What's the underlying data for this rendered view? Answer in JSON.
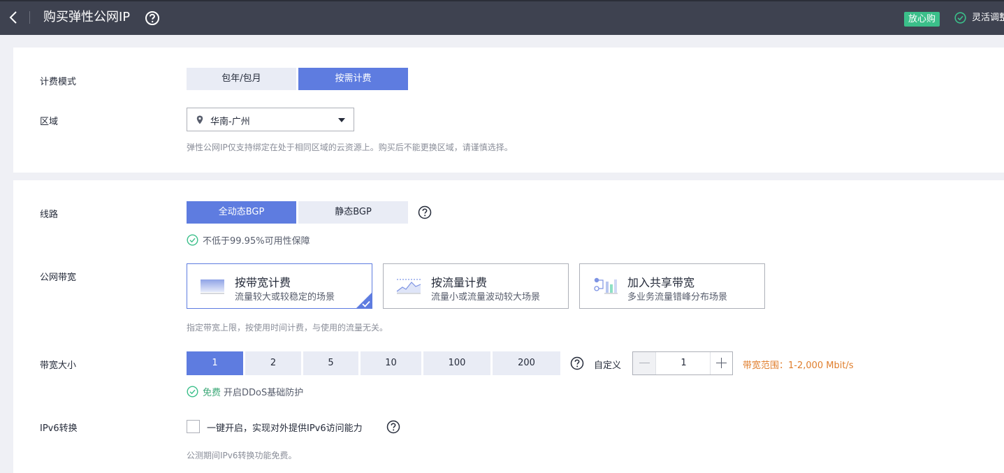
{
  "header": {
    "title": "购买弹性公网IP",
    "badge": "放心购",
    "flex_text": "灵活调整"
  },
  "billing": {
    "label": "计费模式",
    "options": [
      "包年/包月",
      "按需计费"
    ],
    "selected": "按需计费"
  },
  "region": {
    "label": "区域",
    "value": "华南-广州",
    "hint": "弹性公网IP仅支持绑定在处于相同区域的云资源上。购买后不能更换区域，请谨慎选择。"
  },
  "line": {
    "label": "线路",
    "options": [
      "全动态BGP",
      "静态BGP"
    ],
    "selected": "全动态BGP",
    "availability": "不低于99.95%可用性保障"
  },
  "bandwidth_type": {
    "label": "公网带宽",
    "cards": [
      {
        "title": "按带宽计费",
        "desc": "流量较大或较稳定的场景",
        "icon": "bandwidth-billing-icon"
      },
      {
        "title": "按流量计费",
        "desc": "流量小或流量波动较大场景",
        "icon": "traffic-billing-icon"
      },
      {
        "title": "加入共享带宽",
        "desc": "多业务流量错峰分布场景",
        "icon": "shared-bandwidth-icon"
      }
    ],
    "selected": "按带宽计费",
    "hint": "指定带宽上限，按使用时间计费，与使用的流量无关。"
  },
  "bandwidth_size": {
    "label": "带宽大小",
    "options": [
      "1",
      "2",
      "5",
      "10",
      "100",
      "200"
    ],
    "selected": "1",
    "custom_label": "自定义",
    "custom_value": "1",
    "range": "带宽范围：1-2,000 Mbit/s",
    "ddos_free": "免费",
    "ddos_text": "开启DDoS基础防护"
  },
  "ipv6": {
    "label": "IPv6转换",
    "checkbox_label": "一键开启，实现对外提供IPv6访问能力",
    "checked": false,
    "hint": "公测期间IPv6转换功能免费。"
  },
  "colors": {
    "header_bg": "#3e4250",
    "accent": "#5e7ce0",
    "success": "#3bbf8a",
    "warning_text": "#e07e2c"
  }
}
